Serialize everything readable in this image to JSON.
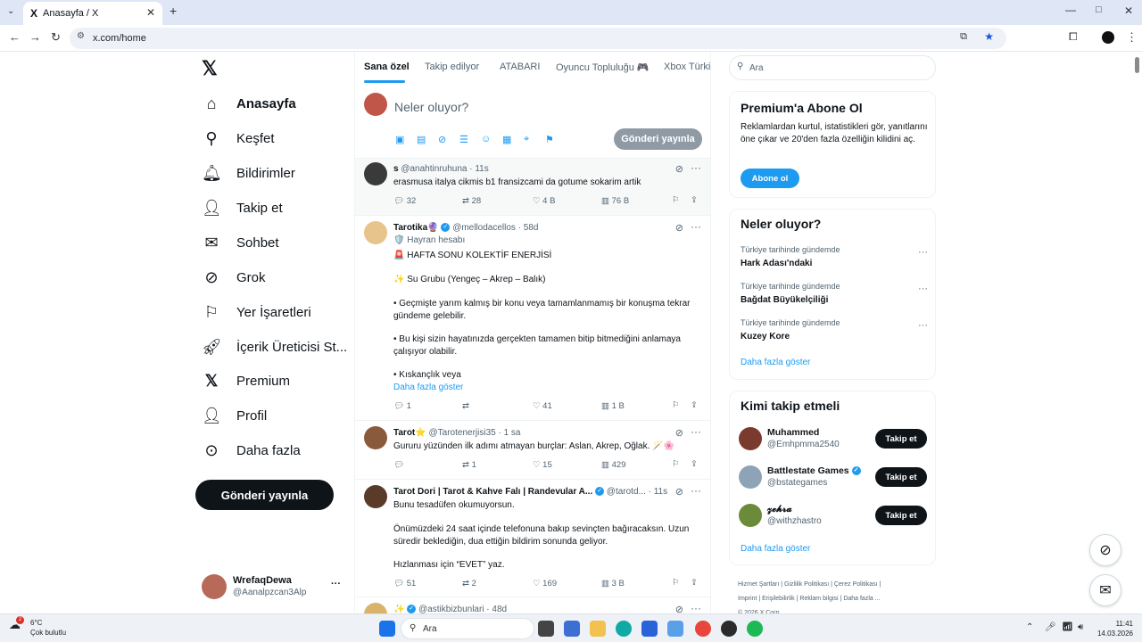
{
  "browser": {
    "tab_title": "Anasayfa / X",
    "tab_logo": "X",
    "tab_close": "✕",
    "tab_add": "+",
    "url": "x.com/home",
    "window_controls": [
      "—",
      "□",
      "✕"
    ]
  },
  "nav": {
    "logo": "𝕏",
    "items": [
      {
        "label": "Anasayfa",
        "icon": "home-icon"
      },
      {
        "label": "Keşfet",
        "icon": "search-icon"
      },
      {
        "label": "Bildirimler",
        "icon": "bell-icon"
      },
      {
        "label": "Takip et",
        "icon": "person-add-icon"
      },
      {
        "label": "Sohbet",
        "icon": "mail-icon"
      },
      {
        "label": "Grok",
        "icon": "grok-icon"
      },
      {
        "label": "Yer İşaretleri",
        "icon": "bookmark-icon"
      },
      {
        "label": "İçerik Üreticisi St...",
        "icon": "rocket-icon"
      },
      {
        "label": "Premium",
        "icon": "x-logo-icon"
      },
      {
        "label": "Profil",
        "icon": "person-icon"
      },
      {
        "label": "Daha fazla",
        "icon": "more-circle-icon"
      }
    ],
    "post_button": "Gönderi yayınla",
    "account": {
      "name": "WrefaqDewa",
      "handle": "@Aanalpzcan3Alp",
      "more": "···"
    }
  },
  "feed": {
    "tabs": [
      "Sana özel",
      "Takip edilyor",
      "ATABARI",
      "Oyuncu Topluluğu 🎮",
      "Xbox Türkiy"
    ],
    "composer": {
      "placeholder": "Neler oluyor?",
      "post_button": "Gönderi yayınla"
    },
    "tweets": [
      {
        "name": "s",
        "handle": "@anahtinruhuna · 11s",
        "text": "erasmusa italya cikmis b1 fransizcami da gotume sokarim artik",
        "replies": "32",
        "retweets": "28",
        "likes": "4 B",
        "views": "76 B"
      },
      {
        "name": "Tarotika🔮",
        "handle": "@mellodacellos · 58d",
        "badge": "🛡️ Hayran hesabı",
        "lines": [
          "🚨 HAFTA SONU KOLEKTİF ENERJİSİ",
          "✨ Su Grubu (Yengeç – Akrep – Balık)",
          "• Geçmişte yarım kalmış bir konu veya tamamlanmamış bir konuşma tekrar gündeme gelebilir.",
          "• Bu kişi sizin hayatınızda gerçekten tamamen bitip bitmediğini anlamaya çalışıyor olabilir.",
          "• Kıskançlık veya"
        ],
        "show_more": "Daha fazla göster",
        "replies": "1",
        "retweets": "",
        "likes": "41",
        "views": "1 B"
      },
      {
        "name": "Tarot⭐",
        "handle": "@Tarotenerjisi35 · 1 sa",
        "text": "Gururu yüzünden ilk adımı atmayan burçlar: Aslan, Akrep, Oğlak. 🪄🌸",
        "replies": "",
        "retweets": "1",
        "likes": "15",
        "views": "429"
      },
      {
        "name": "Tarot Dori | Tarot & Kahve Falı | Randevular A...",
        "handle": "@tarotd... · 11s",
        "lines": [
          "Bunu tesadüfen okumuyorsun.",
          "Önümüzdeki 24 saat içinde telefonuna bakıp sevinçten bağıracaksın. Uzun süredir beklediğin, dua ettiğin bildirim sonunda geliyor.",
          "Hızlanması için “EVET” yaz."
        ],
        "replies": "51",
        "retweets": "2",
        "likes": "169",
        "views": "3 B"
      },
      {
        "name": "✨",
        "handle": "@astikbizbunlari · 48d"
      }
    ]
  },
  "sidebar": {
    "search_placeholder": "Ara",
    "premium": {
      "title": "Premium'a Abone Ol",
      "text": "Reklamlardan kurtul, istatistikleri gör, yanıtlarını öne çıkar ve 20'den fazla özelliğin kilidini aç.",
      "button": "Abone ol"
    },
    "trends": {
      "title": "Neler oluyor?",
      "items": [
        {
          "context": "Türkiye tarihinde gündemde",
          "name": "Hark Adası'ndaki"
        },
        {
          "context": "Türkiye tarihinde gündemde",
          "name": "Bağdat Büyükelçiliği"
        },
        {
          "context": "Türkiye tarihinde gündemde",
          "name": "Kuzey Kore"
        }
      ],
      "show_more": "Daha fazla göster"
    },
    "who_to_follow": {
      "title": "Kimi takip etmeli",
      "items": [
        {
          "name": "Muhammed",
          "handle": "@Emhpmma2540",
          "button": "Takip et",
          "color": "#7a3b2e"
        },
        {
          "name": "Battlestate Games",
          "handle": "@bstategames",
          "button": "Takip et",
          "color": "#8ea3b5"
        },
        {
          "name": "𝔃𝓮𝓱𝓻𝓪",
          "handle": "@withzhastro",
          "button": "Takip et",
          "color": "#6b8a3a"
        }
      ],
      "show_more": "Daha fazla göster"
    },
    "footer": [
      "Hizmet Şartları",
      "Gizlilik Politikası",
      "Çerez Politikası",
      "Imprint",
      "Erişilebilirlik",
      "Reklam bilgisi",
      "Daha fazla ...",
      "© 2026 X Corp."
    ]
  },
  "taskbar": {
    "weather_temp": "6°C",
    "weather_text": "Çok bulutlu",
    "weather_badge": "2",
    "search": "Ara",
    "time": "11:41",
    "date": "14.03.2026"
  },
  "colors": {
    "accent": "#1d9bf0",
    "text": "#0f1419",
    "muted": "#536471"
  }
}
